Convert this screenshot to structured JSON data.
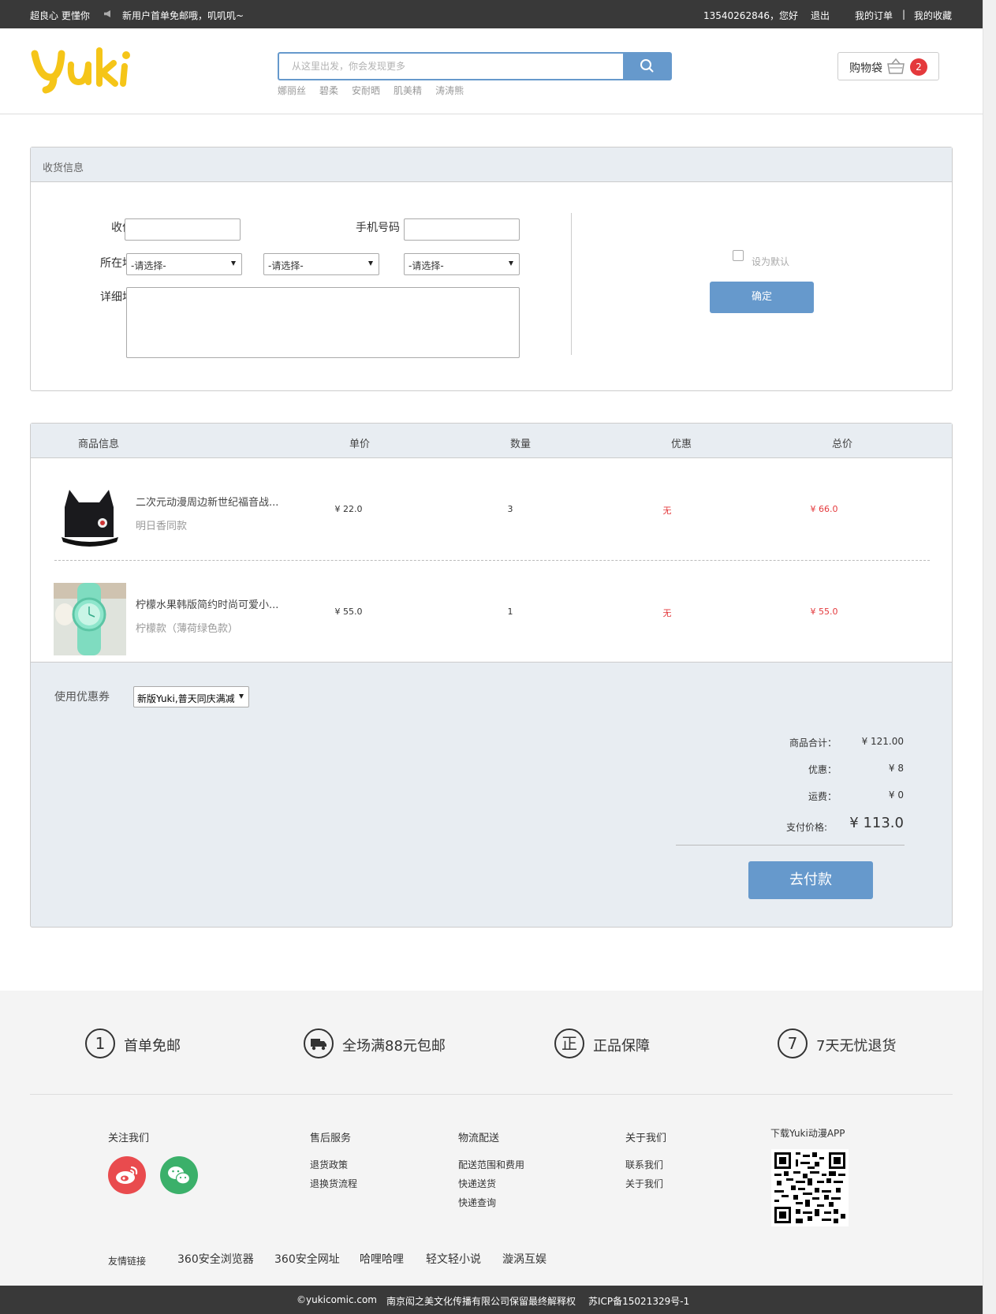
{
  "topbar": {
    "slogan": "超良心 更懂你",
    "notice": "新用户首单免邮哦，叽叽叽~",
    "user": "13540262846，您好",
    "logout": "退出",
    "my_orders": "我的订单",
    "separator": "|",
    "favorites": "我的收藏"
  },
  "header": {
    "logo_text": "Yuki",
    "search_placeholder": "从这里出发，你会发现更多",
    "hot_words": [
      "娜丽丝",
      "碧柔",
      "安耐晒",
      "肌美精",
      "涛涛熊"
    ],
    "cart_label": "购物袋",
    "cart_count": "2"
  },
  "address": {
    "section_title": "收货信息",
    "receiver_label": "收件人",
    "phone_label": "手机号码",
    "region_label": "所在地区",
    "detail_label": "详细地址",
    "province_select": "-请选择-",
    "city_select": "-请选择-",
    "district_select": "-请选择-",
    "set_default_label": "设为默认",
    "confirm_label": "确定"
  },
  "order": {
    "columns": [
      "商品信息",
      "单价",
      "数量",
      "优惠",
      "总价"
    ],
    "items": [
      {
        "name": "二次元动漫周边新世纪福音战...",
        "variant": "明日香同款",
        "price": "¥ 22.0",
        "qty": "3",
        "discount": "无",
        "total": "¥ 66.0"
      },
      {
        "name": "柠檬水果韩版简约时尚可爱小...",
        "variant": "柠檬款（薄荷绿色款）",
        "price": "¥ 55.0",
        "qty": "1",
        "discount": "无",
        "total": "¥ 55.0"
      }
    ],
    "coupon_label": "使用优惠券",
    "coupon_value": "新版Yuki,普天同庆满减",
    "subtotal_label": "商品合计：",
    "subtotal_value": "¥ 121.00",
    "discount_label": "优惠：",
    "discount_value": "¥ 8",
    "shipping_label": "运费：",
    "shipping_value": "¥ 0",
    "pay_price_label": "支付价格:",
    "pay_price_value": "¥ 113.0",
    "pay_button": "去付款"
  },
  "footer": {
    "features": [
      {
        "icon_char": "1",
        "icon": "number-one-circle-icon",
        "text": "首单免邮"
      },
      {
        "icon_char": "",
        "icon": "truck-circle-icon",
        "text": "全场满88元包邮"
      },
      {
        "icon_char": "正",
        "icon": "genuine-circle-icon",
        "text": "正品保障"
      },
      {
        "icon_char": "7",
        "icon": "number-seven-circle-icon",
        "text": "7天无忧退货"
      }
    ],
    "follow_title": "关注我们",
    "after_sale_title": "售后服务",
    "after_sale_items": [
      "退货政策",
      "退换货流程"
    ],
    "logistics_title": "物流配送",
    "logistics_items": [
      "配送范围和费用",
      "快递送货",
      "快递查询"
    ],
    "about_title": "关于我们",
    "about_items": [
      "联系我们",
      "关于我们"
    ],
    "app_title": "下载Yuki动漫APP",
    "friend_links_label": "友情链接",
    "friend_links": [
      "360安全浏览器",
      "360安全网址",
      "哈哩哈哩",
      "轻文轻小说",
      "漩涡互娱"
    ],
    "copyright": "©yukicomic.com",
    "company": "南京闳之美文化传播有限公司保留最终解释权",
    "icp": "苏ICP备15021329号-1"
  },
  "colors": {
    "brand_blue": "#6699cc",
    "price_red": "#e4393c",
    "logo_yellow": "#f5c518",
    "topbar_dark": "#393939",
    "weibo_red": "#e94b4e",
    "wechat_green": "#3bb06a"
  }
}
